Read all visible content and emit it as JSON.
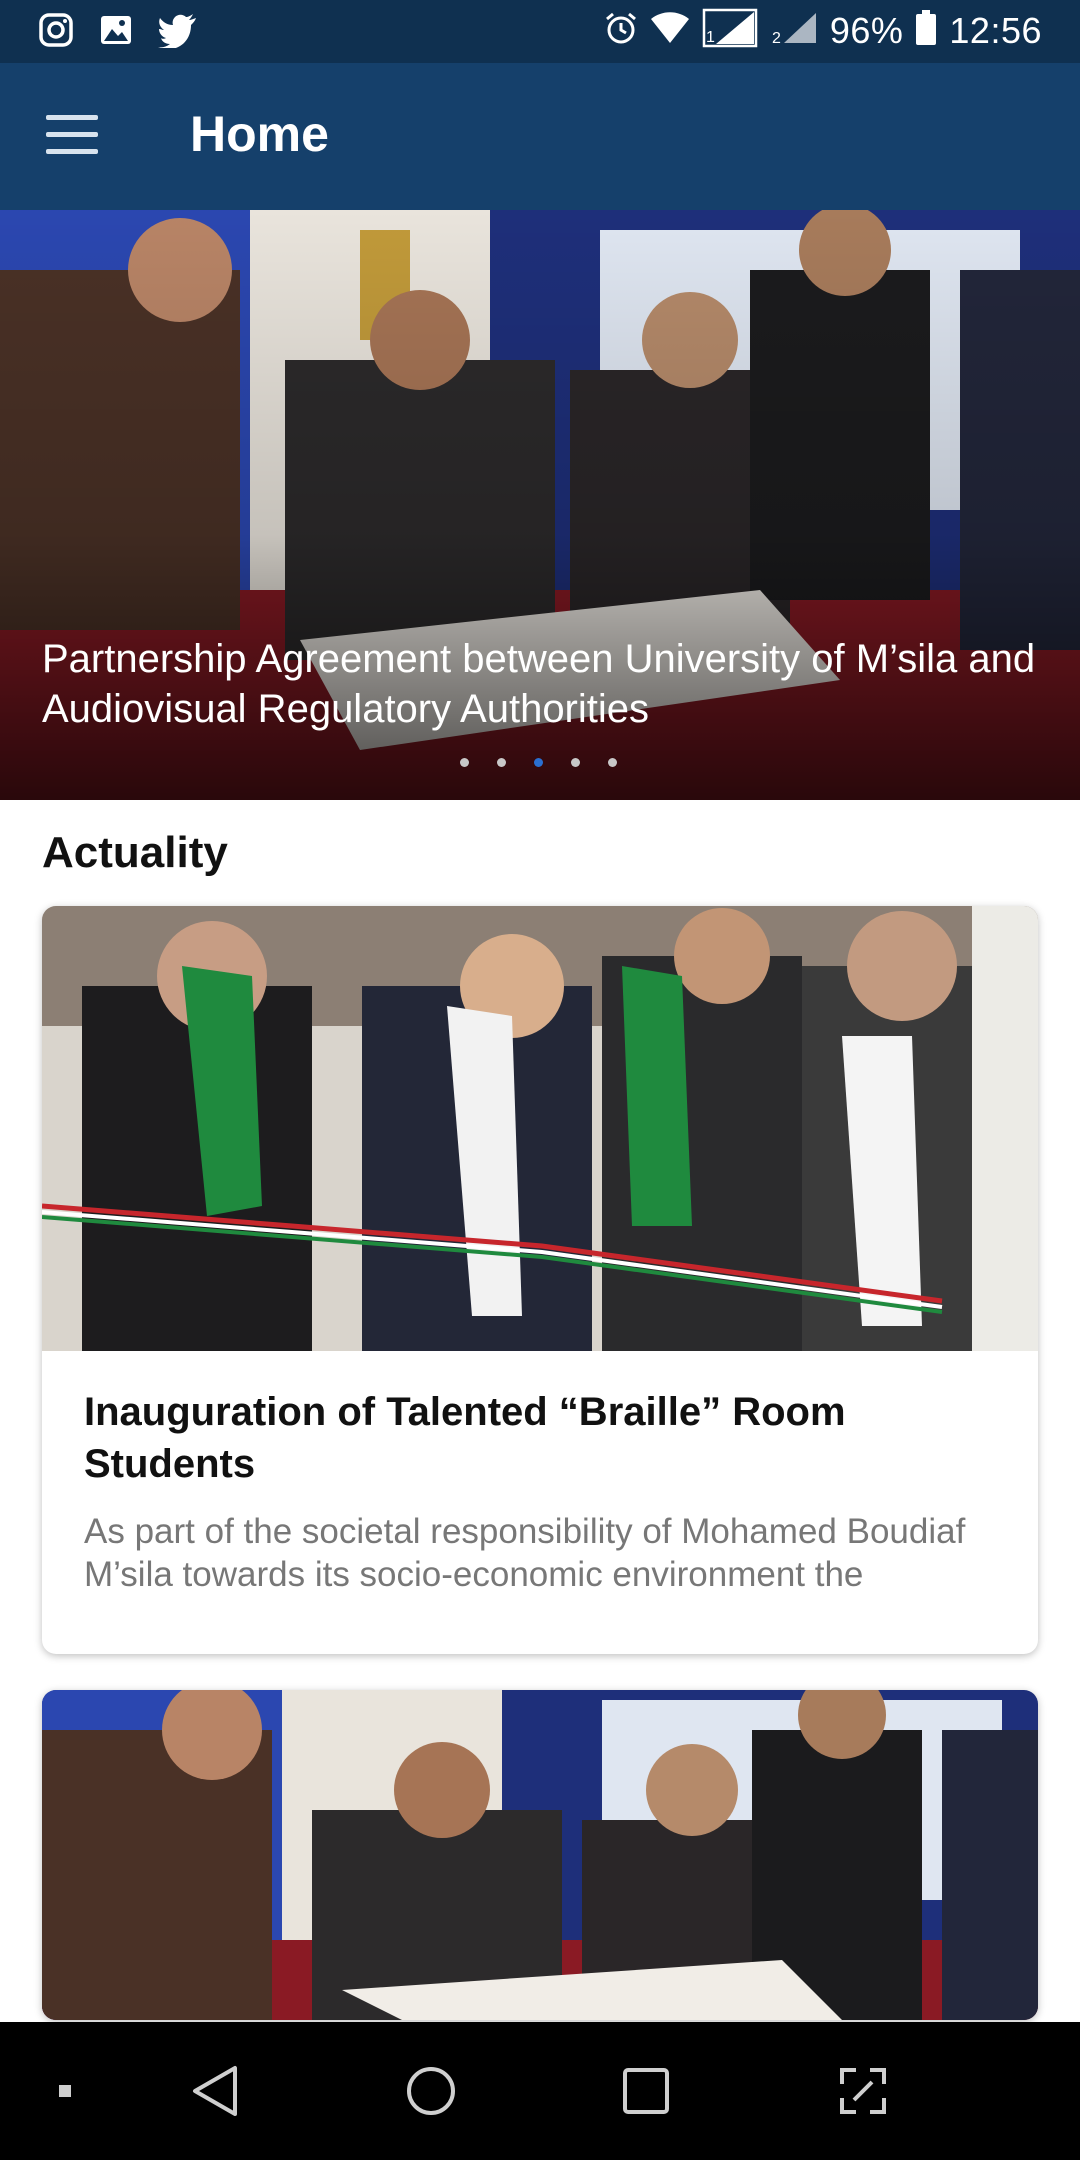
{
  "status_bar": {
    "battery": "96%",
    "time": "12:56",
    "icons": [
      "instagram-icon",
      "gallery-icon",
      "twitter-icon",
      "alarm-icon",
      "wifi-icon",
      "signal-sim1-icon",
      "signal-sim2-icon",
      "battery-icon"
    ]
  },
  "app_bar": {
    "title": "Home",
    "menu_icon": "hamburger-menu-icon"
  },
  "carousel": {
    "caption": "Partnership Agreement between University of M’sila and Audiovisual Regulatory Authorities",
    "slide_count": 5,
    "active_index": 2
  },
  "section": {
    "title": "Actuality"
  },
  "cards": [
    {
      "title": "Inauguration of Talented “Braille” Room Students",
      "description": "As part of the societal responsibility of Mohamed Boudiaf M’sila towards its socio-economic environment the"
    }
  ],
  "nav_bar": {
    "buttons": [
      "dot-icon",
      "back-icon",
      "home-icon",
      "recents-icon",
      "screenshot-icon"
    ]
  },
  "colors": {
    "status_bar": "#0f3050",
    "app_bar": "#15406b",
    "dot_active": "#2a6fd0",
    "dot_inactive": "#c8c8c8"
  }
}
